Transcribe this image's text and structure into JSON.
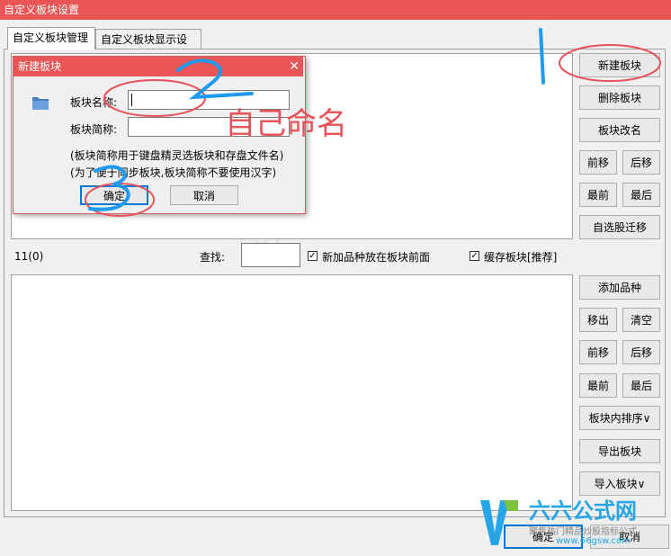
{
  "window": {
    "title": "自定义板块设置"
  },
  "tabs": [
    {
      "label": "自定义板块管理"
    },
    {
      "label": "自定义板块显示设置"
    }
  ],
  "top_buttons": {
    "new": "新建板块",
    "delete": "删除板块",
    "rename": "板块改名",
    "move_up": "前移",
    "move_down": "后移",
    "to_top": "最前",
    "to_bottom": "最后",
    "migrate": "自选股迁移"
  },
  "middle": {
    "count": "11(0)",
    "search_label": "查找:",
    "search_value": "",
    "cb_new_front": {
      "label": "新加品种放在板块前面",
      "checked": true
    },
    "cb_cache": {
      "label": "缓存板块[推荐]",
      "checked": true
    }
  },
  "bottom_buttons": {
    "add": "添加品种",
    "remove": "移出",
    "clear": "清空",
    "move_up": "前移",
    "move_down": "后移",
    "to_top": "最前",
    "to_bottom": "最后",
    "sort": "板块内排序∨",
    "export": "导出板块",
    "import": "导入板块∨"
  },
  "footer": {
    "ok": "确定",
    "cancel": "取消"
  },
  "dialog": {
    "title": "新建板块",
    "name_label": "板块名称:",
    "name_value": "",
    "abbr_label": "板块简称:",
    "abbr_value": "",
    "note1": "(板块简称用于键盘精灵选板块和存盘文件名)",
    "note2": "(为了便于同步板块,板块简称不要使用汉字)",
    "ok": "确定",
    "cancel": "取消"
  },
  "annotations": {
    "n1": "1",
    "n2": "2",
    "n3": "3",
    "note": "自己命名"
  },
  "watermark": {
    "brand": "六六公式网",
    "slogan": "聚焦热门精品炒股指标公式",
    "url": "www.66gsw.com"
  },
  "colors": {
    "titlebar": "#ea5556",
    "annotation_blue": "#1e9bf0",
    "annotation_red": "#e8525a"
  }
}
